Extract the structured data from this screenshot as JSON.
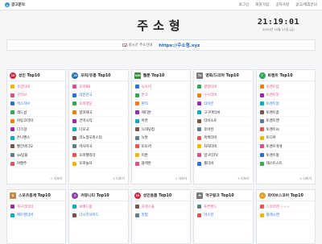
{
  "topbar": {
    "ad_label": "광고문의",
    "links": [
      "로그인",
      "회원가입",
      "공지사항",
      "광고/제휴문의"
    ]
  },
  "header": {
    "title": "주소형",
    "time": "21:19:01",
    "date": "2025년 10월 17일 (금)"
  },
  "address": {
    "label": "실시간 주소안내",
    "url": "https://주소형.xyz"
  },
  "more_label": "+ 더보기",
  "cards": [
    {
      "title": "성인 Top10",
      "badge": "19",
      "items": [
        {
          "text": "조빙티비",
          "color": "#e34b8a"
        },
        {
          "text": "꾸러브",
          "color": "#e34b8a"
        },
        {
          "text": "맥스허브",
          "color": "#2a6fdb"
        },
        {
          "text": "레드섬",
          "color": "#222222"
        },
        {
          "text": "야동코리아",
          "color": "#222222"
        },
        {
          "text": "다크걸",
          "color": "#222222"
        },
        {
          "text": "온나펜스",
          "color": "#222222"
        },
        {
          "text": "빨간비디오",
          "color": "#222222"
        },
        {
          "text": "av탑플",
          "color": "#222222"
        },
        {
          "text": "야짤주",
          "color": "#222222"
        }
      ]
    },
    {
      "title": "오피/유흥 Top10",
      "badge": "19",
      "items": [
        {
          "text": "오피88",
          "color": "#e34b8a"
        },
        {
          "text": "대한민국",
          "color": "#2a6fdb"
        },
        {
          "text": "오피명당",
          "color": "#e34b8a"
        },
        {
          "text": "밤의제국",
          "color": "#222222"
        },
        {
          "text": "건마시티",
          "color": "#222222"
        },
        {
          "text": "다모국",
          "color": "#222222"
        },
        {
          "text": "리노얼오피스타",
          "color": "#222222"
        },
        {
          "text": "마사지국",
          "color": "#222222"
        },
        {
          "text": "오피헬리더",
          "color": "#222222"
        },
        {
          "text": "오피놀자",
          "color": "#222222"
        }
      ]
    },
    {
      "title": "웹툰 Top10",
      "badge": "TOON",
      "items": [
        {
          "text": "뉴토끼",
          "color": "#e34b8a"
        },
        {
          "text": "툰코",
          "color": "#e34b8a"
        },
        {
          "text": "판타",
          "color": "#2a6fdb"
        },
        {
          "text": "제티툰",
          "color": "#222222"
        },
        {
          "text": "아툰",
          "color": "#222222"
        },
        {
          "text": "늑대닷컴",
          "color": "#222222"
        },
        {
          "text": "뉴튠",
          "color": "#222222"
        },
        {
          "text": "토토끼",
          "color": "#222222"
        },
        {
          "text": "미툰",
          "color": "#222222"
        },
        {
          "text": "블랙툰",
          "color": "#222222"
        }
      ]
    },
    {
      "title": "영화/드라마 Top10",
      "badge": "TV",
      "items": [
        {
          "text": "청명티비",
          "color": "#e34b8a"
        },
        {
          "text": "누누티비",
          "color": "#e34b8a"
        },
        {
          "text": "티비몬",
          "color": "#2a6fdb"
        },
        {
          "text": "고구마티비",
          "color": "#222222"
        },
        {
          "text": "티비소프",
          "color": "#222222"
        },
        {
          "text": "후비킹",
          "color": "#222222"
        },
        {
          "text": "목록티비",
          "color": "#222222"
        },
        {
          "text": "차차티비",
          "color": "#222222"
        },
        {
          "text": "밤구티TV",
          "color": "#222222"
        },
        {
          "text": "룰티비",
          "color": "#222222"
        }
      ]
    },
    {
      "title": "토렌트 Top10",
      "badge": "T",
      "items": [
        {
          "text": "토렌트탑",
          "color": "#e34b8a"
        },
        {
          "text": "토렌트봇",
          "color": "#e34b8a"
        },
        {
          "text": "토렌트알",
          "color": "#2a6fdb"
        },
        {
          "text": "토렌트좀",
          "color": "#222222"
        },
        {
          "text": "토렌트맨",
          "color": "#222222"
        },
        {
          "text": "토렌트씨",
          "color": "#222222"
        },
        {
          "text": "토디아",
          "color": "#222222"
        },
        {
          "text": "토렌트큐큐",
          "color": "#222222"
        },
        {
          "text": "토렌트왕",
          "color": "#222222"
        },
        {
          "text": "테스트스트",
          "color": "#222222"
        }
      ]
    },
    {
      "title": "스포츠중계 Top10",
      "badge": "S",
      "items": [
        {
          "text": "개구리티비",
          "color": "#e34b8a"
        },
        {
          "text": "배트맨티비",
          "color": "#2a6fdb"
        }
      ]
    },
    {
      "title": "커뮤니티 Top10",
      "badge": "C",
      "items": [
        {
          "text": "보배드림",
          "color": "#e34b8a"
        },
        {
          "text": "디시인사이드",
          "color": "#2a6fdb"
        }
      ]
    },
    {
      "title": "성인용품 Top10",
      "badge": "19",
      "items": [
        {
          "text": "프렌스돌",
          "color": "#e34b8a"
        },
        {
          "text": "맛팝",
          "color": "#2a6fdb"
        }
      ]
    },
    {
      "title": "먹구링크 Top10",
      "badge": "M",
      "items": [
        {
          "text": "푸른밴드",
          "color": "#e34b8a"
        },
        {
          "text": "마스킹",
          "color": "#2a6fdb"
        }
      ]
    },
    {
      "title": "라이브스코어 Top10",
      "badge": "L",
      "items": [
        {
          "text": "스코어맨 ☆☆☆",
          "color": "#e34b8a"
        },
        {
          "text": "플래시맨",
          "color": "#2a6fdb"
        }
      ]
    }
  ]
}
